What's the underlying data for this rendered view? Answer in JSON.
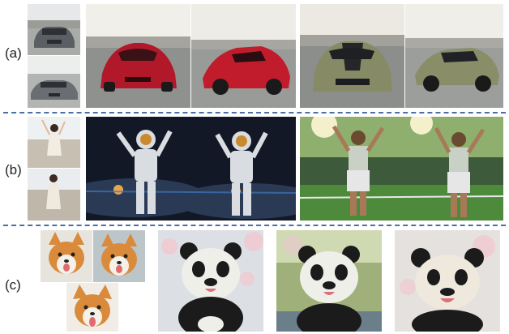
{
  "labels": {
    "a": "(a)",
    "b": "(b)",
    "c": "(c)"
  },
  "colors": {
    "divider": "#4a6fa5",
    "red_car": "#c0202a",
    "olive_car": "#8b8f6a",
    "panda_white": "#efefea",
    "panda_black": "#1b1b1b",
    "corgi": "#d98a3a",
    "space": "#121826"
  }
}
